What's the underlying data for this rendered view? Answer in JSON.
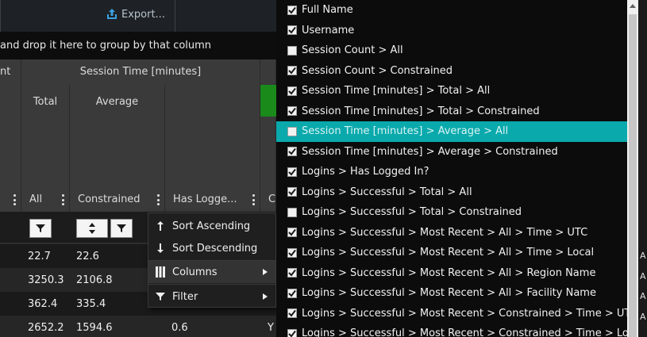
{
  "toolbar": {
    "export_label": "Export..."
  },
  "groupbar": {
    "text": "and drop it here to group by that column"
  },
  "header": {
    "partial_left": "nt",
    "session_time": "Session Time [minutes]",
    "total": "Total",
    "average": "Average",
    "all": "All",
    "constrained": "Constrained",
    "has_logged": "Has Logge...",
    "partial_c": "C"
  },
  "rows": [
    {
      "all": "22.7",
      "constrained": "22.6",
      "extra": "",
      "c": ""
    },
    {
      "all": "3250.3",
      "constrained": "2106.8",
      "extra": "",
      "c": ""
    },
    {
      "all": "362.4",
      "constrained": "335.4",
      "extra": "",
      "c": ""
    },
    {
      "all": "2652.2",
      "constrained": "1594.6",
      "extra": "0.6",
      "c": "Y"
    }
  ],
  "context_menu": {
    "sort_asc": "Sort Ascending",
    "sort_desc": "Sort Descending",
    "columns": "Columns",
    "filter": "Filter"
  },
  "column_chooser": [
    {
      "label": "Full Name",
      "checked": true
    },
    {
      "label": "Username",
      "checked": true
    },
    {
      "label": "Session Count > All",
      "checked": false
    },
    {
      "label": "Session Count > Constrained",
      "checked": true
    },
    {
      "label": "Session Time [minutes] > Total > All",
      "checked": true
    },
    {
      "label": "Session Time [minutes] > Total > Constrained",
      "checked": true
    },
    {
      "label": "Session Time [minutes] > Average > All",
      "checked": false,
      "active": true
    },
    {
      "label": "Session Time [minutes] > Average > Constrained",
      "checked": true
    },
    {
      "label": "Logins > Has Logged In?",
      "checked": true
    },
    {
      "label": "Logins > Successful > Total > All",
      "checked": true
    },
    {
      "label": "Logins > Successful > Total > Constrained",
      "checked": false
    },
    {
      "label": "Logins > Successful > Most Recent > All > Time > UTC",
      "checked": true
    },
    {
      "label": "Logins > Successful > Most Recent > All > Time > Local",
      "checked": true
    },
    {
      "label": "Logins > Successful > Most Recent > All > Region Name",
      "checked": true
    },
    {
      "label": "Logins > Successful > Most Recent > All > Facility Name",
      "checked": true
    },
    {
      "label": "Logins > Successful > Most Recent > Constrained > Time > UTC",
      "checked": true
    },
    {
      "label": "Logins > Successful > Most Recent > Constrained > Time > Local",
      "checked": true
    }
  ],
  "right_edge_letter": "A",
  "colors": {
    "accent": "#0aa9ac",
    "green": "#1a8a1a"
  },
  "icons": [
    "export-icon",
    "kebab-icon",
    "filter-icon",
    "sort-icon",
    "arrow-up-icon",
    "arrow-down-icon",
    "columns-icon",
    "chevron-right-icon",
    "checkbox-icon"
  ]
}
